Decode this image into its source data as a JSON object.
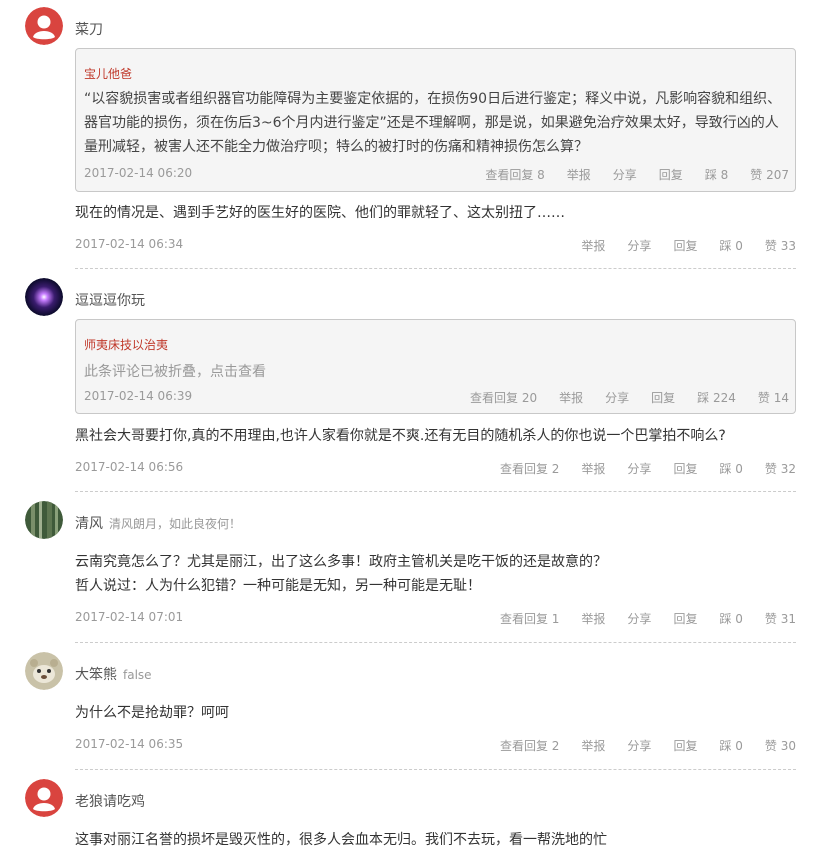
{
  "comments": [
    {
      "user": "菜刀",
      "quote": {
        "author": "宝儿他爸",
        "text": "“以容貌损害或者组织器官功能障碍为主要鉴定依据的，在损伤90日后进行鉴定；释义中说，凡影响容貌和组织、器官功能的损伤，须在伤后3~6个月内进行鉴定”还是不理解啊，那是说，如果避免治疗效果太好，导致行凶的人量刑减轻，被害人还不能全力做治疗呗；特么的被打时的伤痛和精神损伤怎么算？",
        "time": "2017-02-14 06:20",
        "view_replies": "查看回复 8",
        "report": "举报",
        "share": "分享",
        "reply": "回复",
        "dislike": "踩 8",
        "like": "赞 207"
      },
      "lines": [
        "现在的情况是、遇到手艺好的医生好的医院、他们的罪就轻了、这太别扭了……"
      ],
      "time": "2017-02-14 06:34",
      "report": "举报",
      "share": "分享",
      "reply": "回复",
      "dislike": "踩 0",
      "like": "赞 33"
    },
    {
      "user": "逗逗逗你玩",
      "quote": {
        "author": "师夷床技以治夷",
        "folded": "此条评论已被折叠，点击查看",
        "time": "2017-02-14 06:39",
        "view_replies": "查看回复 20",
        "report": "举报",
        "share": "分享",
        "reply": "回复",
        "dislike": "踩 224",
        "like": "赞 14"
      },
      "lines": [
        "黑社会大哥要打你,真的不用理由,也许人家看你就是不爽.还有无目的随机杀人的你也说一个巴掌拍不响么?"
      ],
      "time": "2017-02-14 06:56",
      "view_replies": "查看回复 2",
      "report": "举报",
      "share": "分享",
      "reply": "回复",
      "dislike": "踩 0",
      "like": "赞 32"
    },
    {
      "user": "清风",
      "signature": "清风朗月，如此良夜何！",
      "lines": [
        "云南究竟怎么了？尤其是丽江，出了这么多事！政府主管机关是吃干饭的还是故意的？",
        "哲人说过：人为什么犯错？一种可能是无知，另一种可能是无耻！"
      ],
      "time": "2017-02-14 07:01",
      "view_replies": "查看回复 1",
      "report": "举报",
      "share": "分享",
      "reply": "回复",
      "dislike": "踩 0",
      "like": "赞 31"
    },
    {
      "user": "大笨熊",
      "signature": "false",
      "lines": [
        "为什么不是抢劫罪？呵呵"
      ],
      "time": "2017-02-14 06:35",
      "view_replies": "查看回复 2",
      "report": "举报",
      "share": "分享",
      "reply": "回复",
      "dislike": "踩 0",
      "like": "赞 30"
    },
    {
      "user": "老狼请吃鸡",
      "lines": [
        "这事对丽江名誉的损坏是毁灭性的，很多人会血本无归。我们不去玩，看一帮洗地的忙"
      ]
    }
  ]
}
